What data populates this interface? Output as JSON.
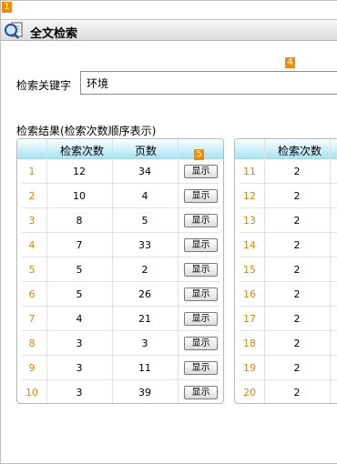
{
  "markers": {
    "m1": "1",
    "m4": "4",
    "m5": "5"
  },
  "window": {
    "title": "全文检索"
  },
  "search": {
    "label": "检索关键字",
    "value": "环境"
  },
  "results": {
    "label": "检索结果(检索次数顺序表示)",
    "headers": {
      "count": "检索次数",
      "page": "页数"
    },
    "button_label": "显示",
    "left_rows": [
      {
        "no": "1",
        "count": "12",
        "page": "34"
      },
      {
        "no": "2",
        "count": "10",
        "page": "4"
      },
      {
        "no": "3",
        "count": "8",
        "page": "5"
      },
      {
        "no": "4",
        "count": "7",
        "page": "33"
      },
      {
        "no": "5",
        "count": "5",
        "page": "2"
      },
      {
        "no": "6",
        "count": "5",
        "page": "26"
      },
      {
        "no": "7",
        "count": "4",
        "page": "21"
      },
      {
        "no": "8",
        "count": "3",
        "page": "3"
      },
      {
        "no": "9",
        "count": "3",
        "page": "11"
      },
      {
        "no": "10",
        "count": "3",
        "page": "39"
      }
    ],
    "right_rows": [
      {
        "no": "11",
        "count": "2"
      },
      {
        "no": "12",
        "count": "2"
      },
      {
        "no": "13",
        "count": "2"
      },
      {
        "no": "14",
        "count": "2"
      },
      {
        "no": "15",
        "count": "2"
      },
      {
        "no": "16",
        "count": "2"
      },
      {
        "no": "17",
        "count": "2"
      },
      {
        "no": "18",
        "count": "2"
      },
      {
        "no": "19",
        "count": "2"
      },
      {
        "no": "20",
        "count": "2"
      }
    ]
  },
  "colors": {
    "index_number": "#d4880f",
    "header_gradient_end": "#a9e3f2",
    "marker": "#f08c0c"
  },
  "icons": {
    "title": "document-search-icon"
  }
}
